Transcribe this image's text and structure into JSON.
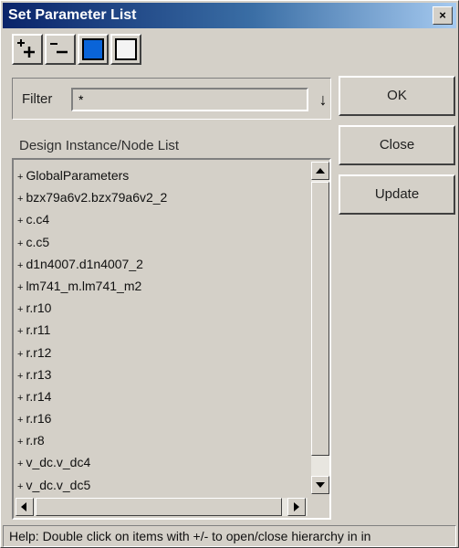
{
  "window": {
    "title": "Set Parameter List",
    "close_glyph": "×"
  },
  "toolbar": {
    "buttons": [
      {
        "name": "expand-plus-icon"
      },
      {
        "name": "collapse-minus-icon"
      },
      {
        "name": "blue-square-icon"
      },
      {
        "name": "white-square-icon"
      }
    ]
  },
  "filter": {
    "label": "Filter",
    "value": "*",
    "dropdown_glyph": "↓"
  },
  "actions": {
    "ok": "OK",
    "close": "Close",
    "update": "Update"
  },
  "list": {
    "label": "Design Instance/Node List",
    "bullet": "+",
    "items": [
      "GlobalParameters",
      "bzx79a6v2.bzx79a6v2_2",
      "c.c4",
      "c.c5",
      "d1n4007.d1n4007_2",
      "lm741_m.lm741_m2",
      "r.r10",
      "r.r11",
      "r.r12",
      "r.r13",
      "r.r14",
      "r.r16",
      "r.r8",
      "v_dc.v_dc4",
      "v_dc.v_dc5"
    ]
  },
  "status": {
    "help_text": "Help: Double click on items with +/- to open/close hierarchy in in"
  },
  "colors": {
    "title_dark": "#0a246a",
    "title_light": "#a6caf0",
    "face": "#d4d0c8",
    "accent_blue": "#0a64d8"
  }
}
